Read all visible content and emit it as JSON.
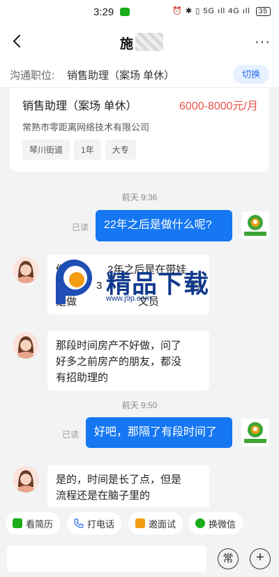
{
  "status_bar": {
    "time": "3:29",
    "icons_text": "⏰ ✱ ▯ 5G ıll 4G ıll",
    "battery": "35"
  },
  "header": {
    "title": "施",
    "more": "···"
  },
  "position": {
    "label": "沟通职位:",
    "value": "销售助理（案场 单休）",
    "switch_label": "切换"
  },
  "job": {
    "title": "销售助理（案场 单休）",
    "salary": "6000-8000元/月",
    "company": "常熟市零距离网络技术有限公司",
    "tags": [
      "琴川街道",
      "1年",
      "大专"
    ]
  },
  "messages": {
    "time1": "前天 9:36",
    "read1": "已读",
    "me1": "22年之后是做什么呢?",
    "other1_lines": [
      "做",
      "2年之后是在带娃",
      "",
      "写",
      "3",
      "的",
      "是做",
      "文员"
    ],
    "other2_lines": [
      "那段时间房产不好做，问了",
      "好多之前房产的朋友，都没",
      "有招助理的"
    ],
    "time2": "前天 9:50",
    "read2": "已读",
    "me2": "好吧，那隔了有段时间了",
    "other3_lines": [
      "是的，时间是长了点，但是",
      "流程还是在脑子里的"
    ]
  },
  "watermark": {
    "text": "精品下载",
    "url": "www.j9p.com",
    "avatar_text": "零距离家"
  },
  "quick_actions": [
    "看简历",
    "打电话",
    "邀面试",
    "换微信"
  ],
  "input": {
    "common_label": "常",
    "plus_label": "+"
  },
  "colors": {
    "accent": "#1677f2",
    "salary": "#e8534a",
    "wechat": "#1aad19"
  }
}
